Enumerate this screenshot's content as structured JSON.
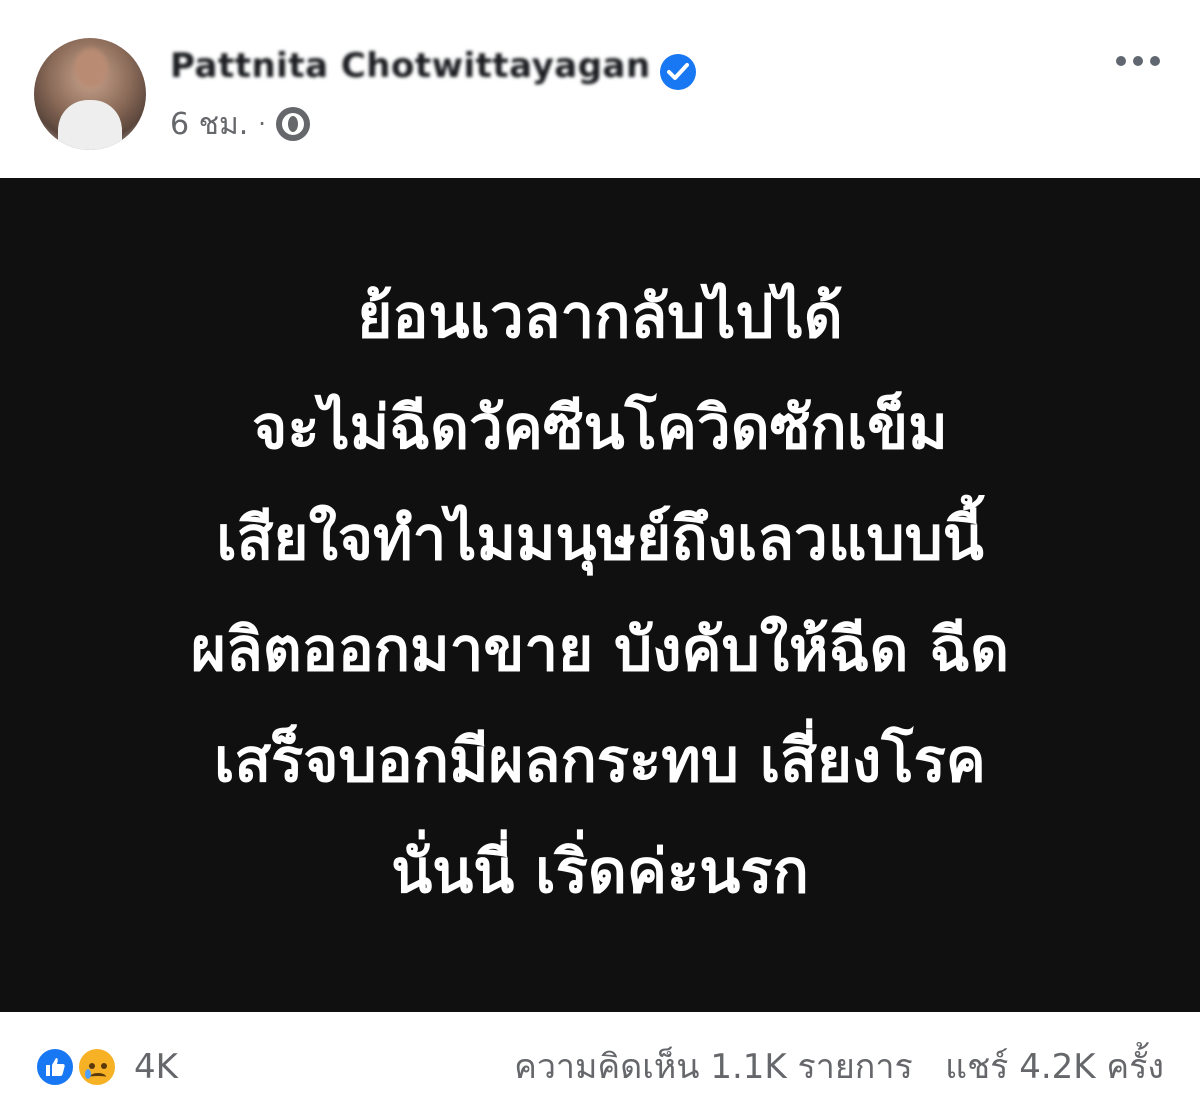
{
  "post": {
    "author_name": "Pattnita Chotwittayagan",
    "timestamp": "6 ชม.",
    "separator": "·",
    "privacy_icon": "globe-icon",
    "verified_icon": "verified-badge-icon",
    "more_icon": "more-options-icon",
    "body_bg": "#101010",
    "lines": [
      "ย้อนเวลากลับไปได้",
      "จะไม่ฉีดวัคซีนโควิดซักเข็ม",
      "เสียใจทำไมมนุษย์ถึงเลวแบบนี้",
      "ผลิตออกมาขาย บังคับให้ฉีด ฉีด",
      "เสร็จบอกมีผลกระทบ เสี่ยงโรค",
      "นั่นนี่ เริ่ดค่ะนรก"
    ]
  },
  "footer": {
    "reactions": [
      "like-icon",
      "sad-icon"
    ],
    "reaction_count": "4K",
    "comments": "ความคิดเห็น 1.1K รายการ",
    "shares": "แชร์ 4.2K ครั้ง"
  },
  "colors": {
    "accent": "#1877f2",
    "muted_text": "#65676b"
  }
}
